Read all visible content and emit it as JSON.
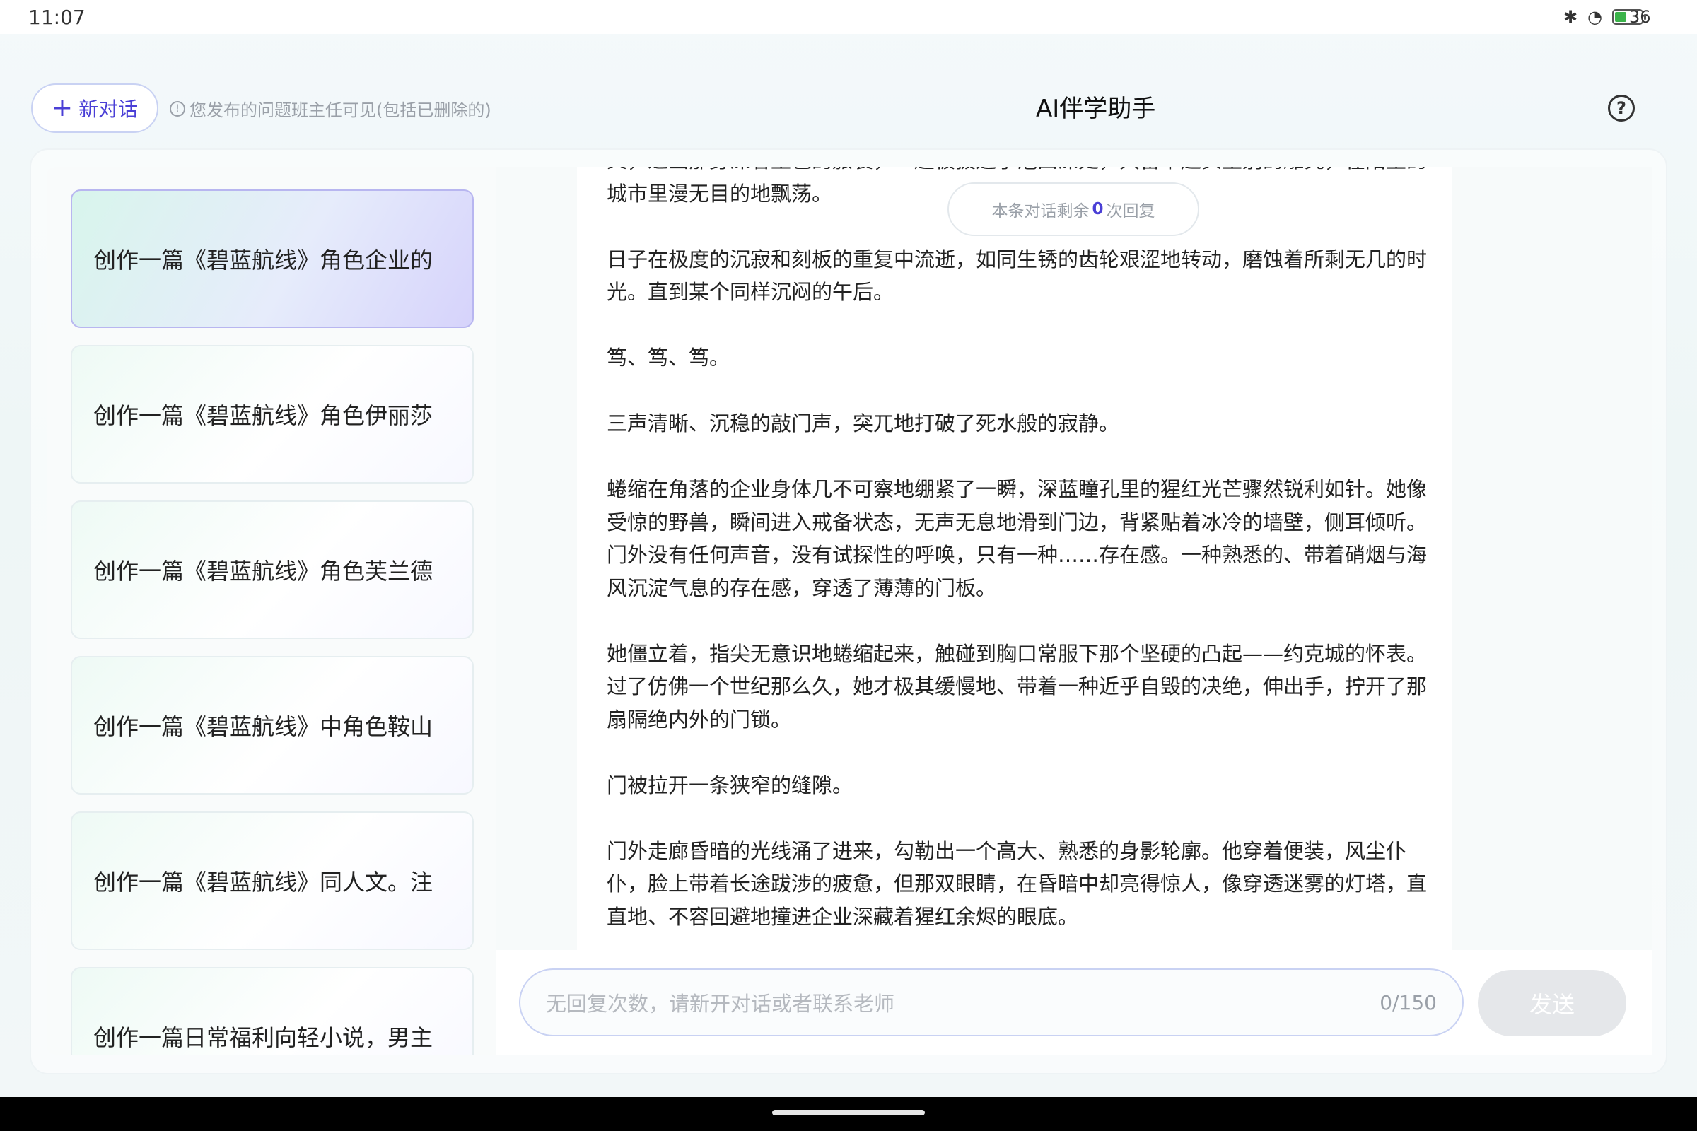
{
  "status_bar": {
    "time": "11:07",
    "battery": "36",
    "icons": [
      "bluetooth-icon",
      "wifi-icon",
      "battery-icon"
    ]
  },
  "header": {
    "new_chat_label": "新对话",
    "notice": "您发布的问题班主任可见(包括已删除的)",
    "title": "AI伴学助手"
  },
  "sidebar": {
    "items": [
      {
        "label": "创作一篇《碧蓝航线》角色企业的",
        "active": true
      },
      {
        "label": "创作一篇《碧蓝航线》角色伊丽莎",
        "active": false
      },
      {
        "label": "创作一篇《碧蓝航线》角色芙兰德",
        "active": false
      },
      {
        "label": "创作一篇《碧蓝航线》中角色鞍山",
        "active": false
      },
      {
        "label": "创作一篇《碧蓝航线》同人文。注",
        "active": false
      },
      {
        "label": "创作一篇日常福利向轻小说，男主",
        "active": false
      }
    ]
  },
  "chat": {
    "remaining_prefix": "本条对话剩余",
    "remaining_count": "0",
    "remaining_suffix": "次回复",
    "paragraphs": [
      "义，过凶那身深者型色的旅装，一趟被拔进了泡凹深处，只留下起头生别的雕究，在陌生的城市里漫无目的地飘荡。",
      "日子在极度的沉寂和刻板的重复中流逝，如同生锈的齿轮艰涩地转动，磨蚀着所剩无几的时光。直到某个同样沉闷的午后。",
      "笃、笃、笃。",
      "三声清晰、沉稳的敲门声，突兀地打破了死水般的寂静。",
      "蜷缩在角落的企业身体几不可察地绷紧了一瞬，深蓝瞳孔里的猩红光芒骤然锐利如针。她像受惊的野兽，瞬间进入戒备状态，无声无息地滑到门边，背紧贴着冰冷的墙壁，侧耳倾听。门外没有任何声音，没有试探性的呼唤，只有一种……存在感。一种熟悉的、带着硝烟与海风沉淀气息的存在感，穿透了薄薄的门板。",
      "她僵立着，指尖无意识地蜷缩起来，触碰到胸口常服下那个坚硬的凸起——约克城的怀表。过了仿佛一个世纪那么久，她才极其缓慢地、带着一种近乎自毁的决绝，伸出手，拧开了那扇隔绝内外的门锁。",
      "门被拉开一条狭窄的缝隙。",
      "门外走廊昏暗的光线涌了进来，勾勒出一个高大、熟悉的身影轮廓。他穿着便装，风尘仆仆，脸上带着长途跋涉的疲惫，但那双眼睛，在昏暗中却亮得惊人，像穿透迷雾的灯塔，直直地、不容回避地撞进企业深藏着猩红余烬的眼底。"
    ]
  },
  "input": {
    "placeholder": "无回复次数，请新开对话或者联系老师",
    "counter": "0/150",
    "send_label": "发送"
  },
  "colors": {
    "accent": "#4a3fd6",
    "active_item_gradient_end": "#d6d3fb",
    "send_disabled": "#e5e7ea"
  }
}
